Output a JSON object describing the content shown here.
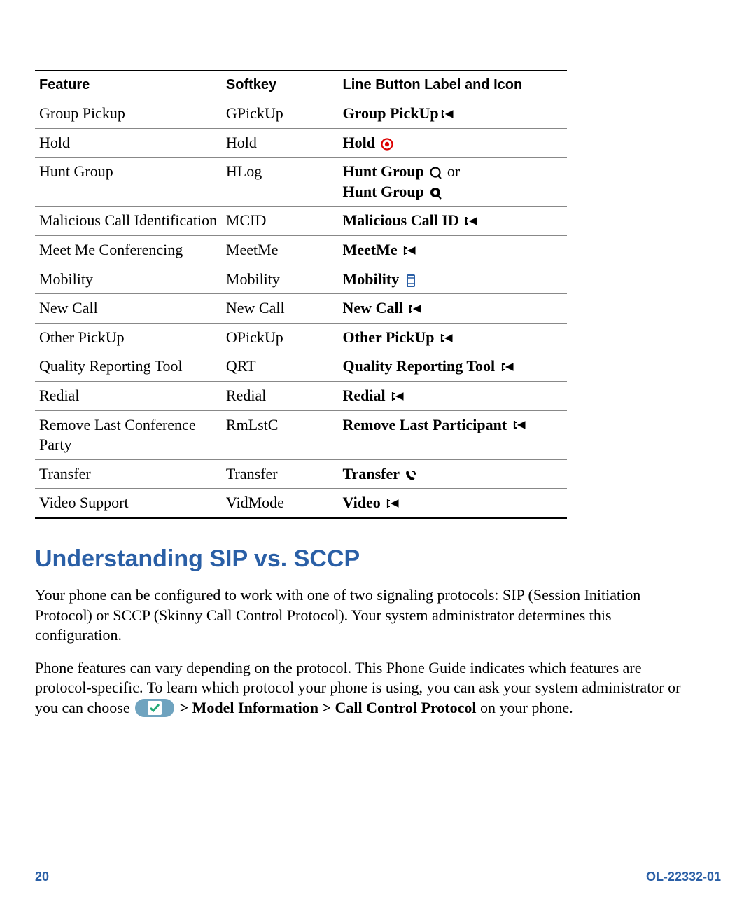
{
  "table": {
    "headers": [
      "Feature",
      "Softkey",
      "Line Button Label and Icon"
    ],
    "rows": [
      {
        "feature": "Group Pickup",
        "softkey": "GPickUp",
        "label_parts": [
          {
            "t": "Group PickUp",
            "icon": "plf"
          }
        ]
      },
      {
        "feature": "Hold",
        "softkey": "Hold",
        "label_parts": [
          {
            "t": "Hold ",
            "icon": "hold"
          }
        ]
      },
      {
        "feature": "Hunt Group",
        "softkey": "HLog",
        "label_parts": [
          {
            "t": "Hunt Group ",
            "icon": "hunt-open",
            "after_normal": " or"
          },
          {
            "br": true
          },
          {
            "t": "Hunt Group ",
            "icon": "hunt-filled"
          }
        ]
      },
      {
        "feature": "Malicious Call Identification",
        "softkey": "MCID",
        "label_parts": [
          {
            "t": "Malicious Call ID ",
            "icon": "plf"
          }
        ]
      },
      {
        "feature": "Meet Me Conferencing",
        "softkey": "MeetMe",
        "label_parts": [
          {
            "t": "MeetMe ",
            "icon": "plf"
          }
        ]
      },
      {
        "feature": "Mobility",
        "softkey": "Mobility",
        "label_parts": [
          {
            "t": "Mobility ",
            "icon": "mobility"
          }
        ]
      },
      {
        "feature": "New Call",
        "softkey": "New Call",
        "label_parts": [
          {
            "t": "New Call ",
            "icon": "plf"
          }
        ]
      },
      {
        "feature": "Other PickUp",
        "softkey": "OPickUp",
        "label_parts": [
          {
            "t": "Other PickUp ",
            "icon": "plf"
          }
        ]
      },
      {
        "feature": "Quality Reporting Tool",
        "softkey": "QRT",
        "label_parts": [
          {
            "t": "Quality Reporting Tool ",
            "icon": "plf"
          }
        ]
      },
      {
        "feature": "Redial",
        "softkey": "Redial",
        "label_parts": [
          {
            "t": "Redial ",
            "icon": "plf"
          }
        ]
      },
      {
        "feature": "Remove Last Conference Party",
        "softkey": "RmLstC",
        "label_parts": [
          {
            "t": "Remove Last Participant ",
            "icon": "plf"
          }
        ]
      },
      {
        "feature": "Transfer",
        "softkey": "Transfer",
        "label_parts": [
          {
            "t": "Transfer ",
            "icon": "transfer"
          }
        ]
      },
      {
        "feature": "Video Support",
        "softkey": "VidMode",
        "label_parts": [
          {
            "t": "Video ",
            "icon": "plf"
          }
        ]
      }
    ]
  },
  "section": {
    "title": "Understanding SIP vs. SCCP",
    "p1": "Your phone can be configured to work with one of two signaling protocols: SIP (Session Initiation Protocol) or SCCP (Skinny Call Control Protocol). Your system administrator determines this configuration.",
    "p2_a": "Phone features can vary depending on the protocol. This Phone Guide indicates which features are protocol-specific. To learn which protocol your phone is using, you can ask your system administrator or you can choose ",
    "p2_nav": " > Model Information > Call Control Protocol",
    "p2_b": " on your phone."
  },
  "footer": {
    "page": "20",
    "doc": "OL-22332-01"
  }
}
